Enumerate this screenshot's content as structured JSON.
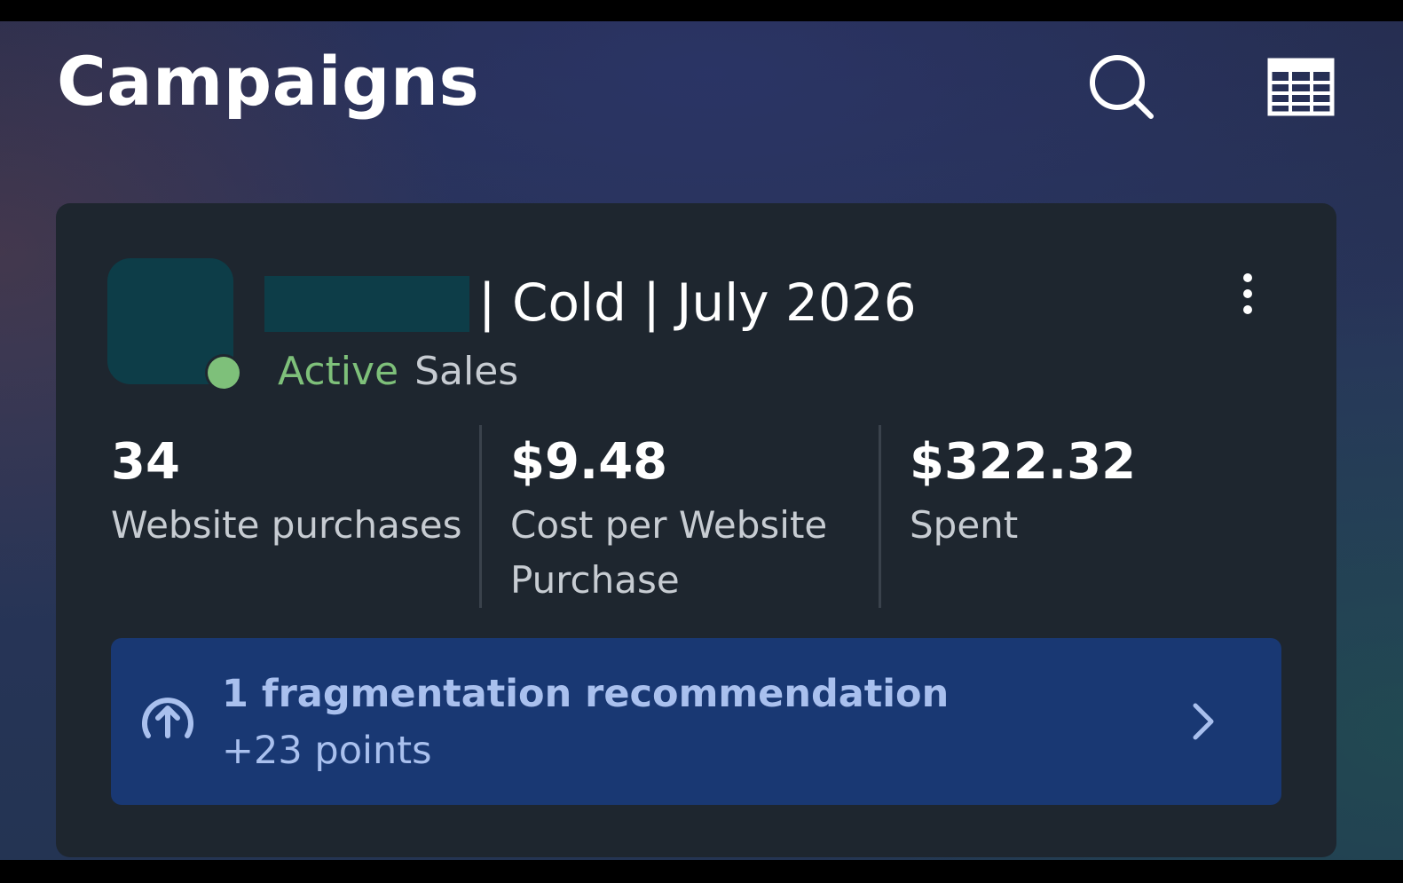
{
  "header": {
    "title": "Campaigns",
    "search_icon": "search-icon",
    "table_icon": "table-view-icon"
  },
  "campaign": {
    "name_suffix": "| Cold | July 2026",
    "status": "Active",
    "objective": "Sales",
    "status_color": "#7ec07a",
    "more_icon": "more-vertical-icon",
    "metrics": [
      {
        "value": "34",
        "label": "Website purchases"
      },
      {
        "value": "$9.48",
        "label": "Cost per Website Purchase"
      },
      {
        "value": "$322.32",
        "label": "Spent"
      }
    ],
    "recommendation": {
      "title": "1 fragmentation recommendation",
      "points": "+23 points",
      "icon": "arrow-up-circle-icon",
      "chevron_icon": "chevron-right-icon",
      "background": "#193873"
    }
  }
}
